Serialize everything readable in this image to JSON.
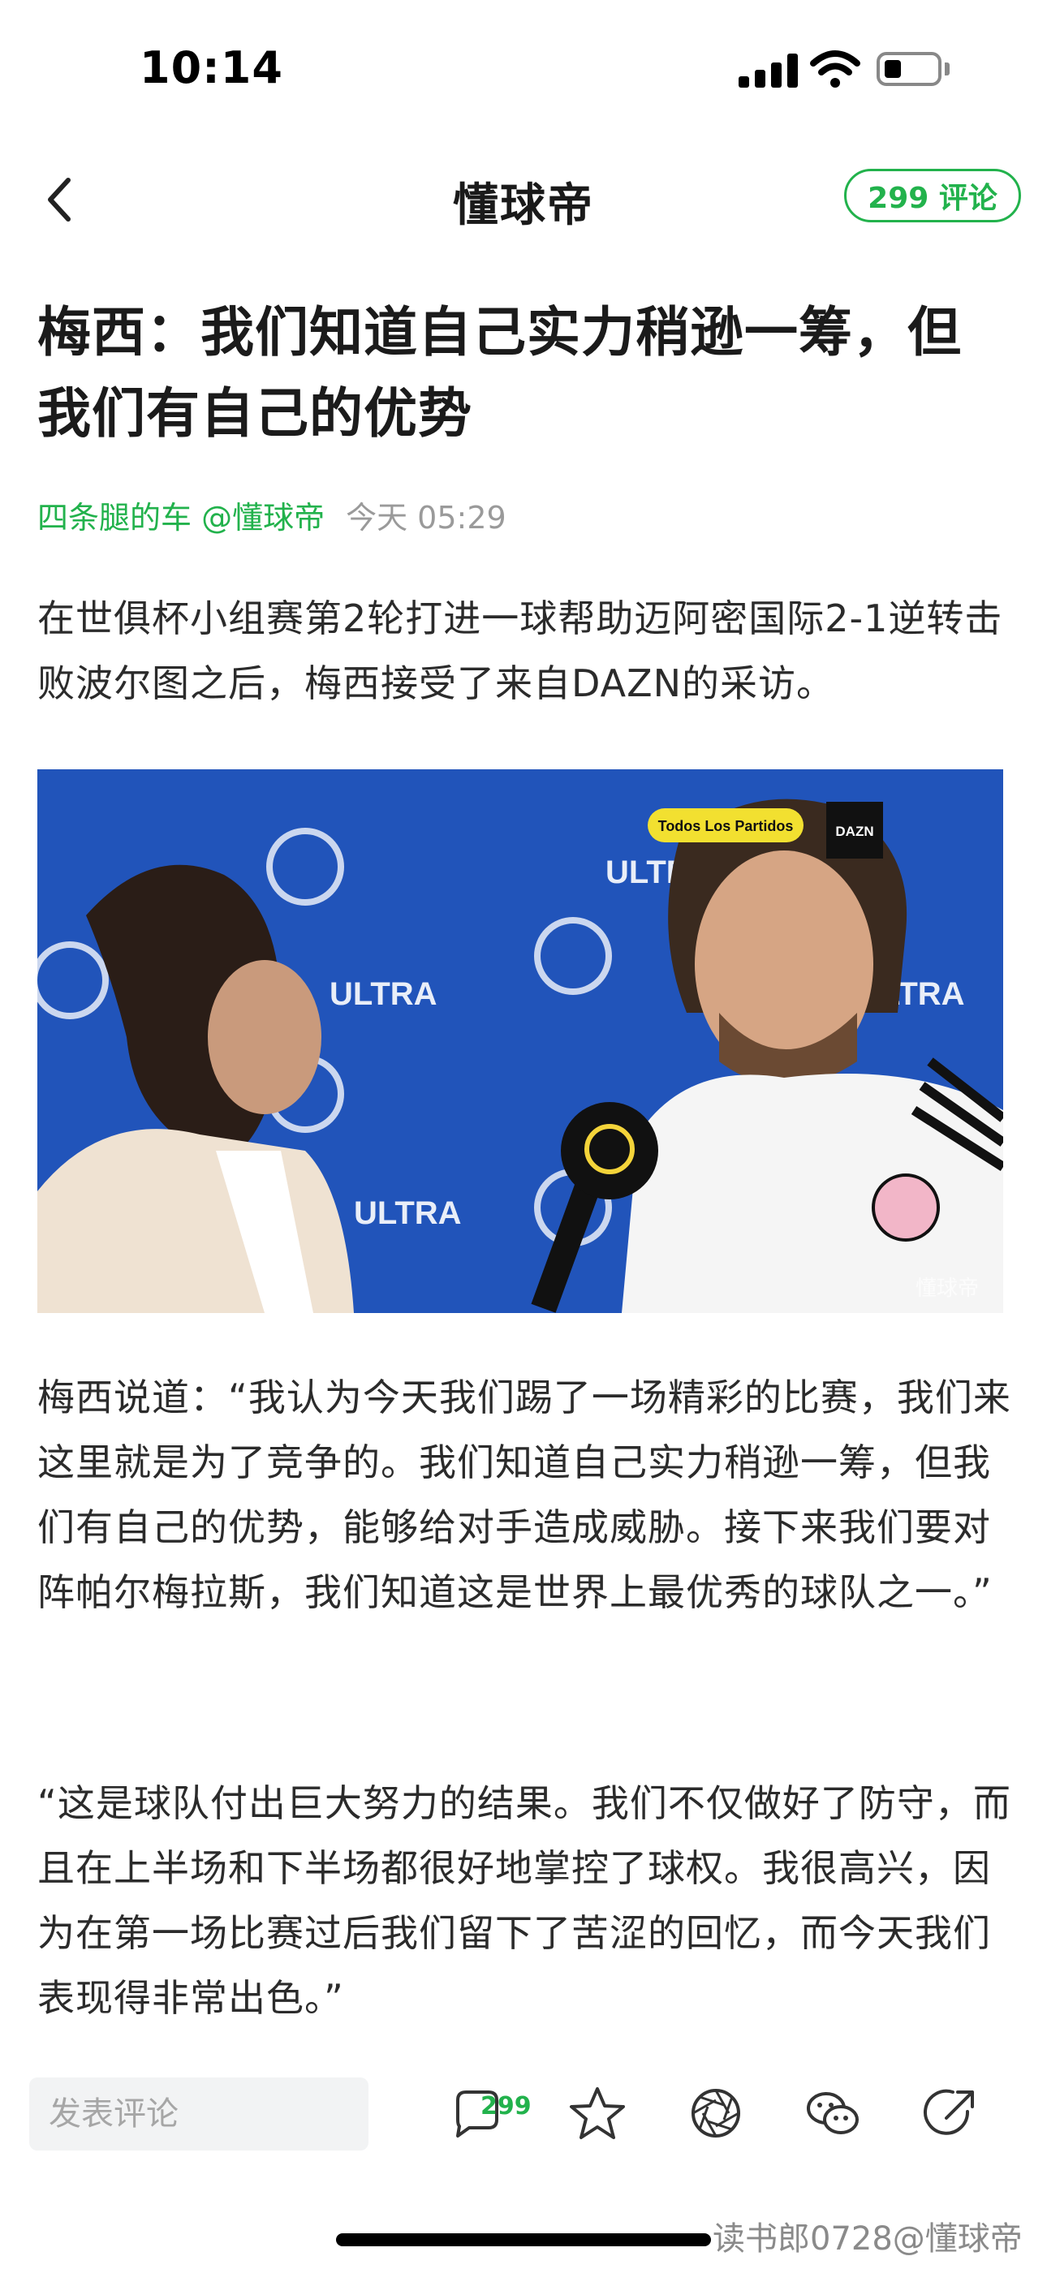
{
  "status_bar": {
    "time": "10:14"
  },
  "nav": {
    "title": "懂球帝",
    "comment_count_label": "299 评论"
  },
  "article": {
    "title": "梅西：我们知道自己实力稍逊一筹，但我们有自己的优势",
    "author": "四条腿的车 @懂球帝",
    "time": "今天 05:29",
    "paragraphs": [
      "在世俱杯小组赛第2轮打进一球帮助迈阿密国际2-1逆转击败波尔图之后，梅西接受了来自DAZN的采访。",
      "梅西说道：“我认为今天我们踢了一场精彩的比赛，我们来这里就是为了竞争的。我们知道自己实力稍逊一筹，但我们有自己的优势，能够给对手造成威胁。接下来我们要对阵帕尔梅拉斯，我们知道这是世界上最优秀的球队之一。”",
      "“这是球队付出巨大努力的结果。我们不仅做好了防守，而且在上半场和下半场都很好地掌控了球权。我很高兴，因为在第一场比赛过后我们留下了苦涩的回忆，而今天我们表现得非常出色。”"
    ],
    "image": {
      "tag": "Todos Los Partidos",
      "broadcaster": "DAZN",
      "backdrop_text": "ULTRA",
      "watermark": "懂球帝"
    }
  },
  "bottom_bar": {
    "comment_placeholder": "发表评论",
    "comment_badge": "299"
  },
  "overlay_watermark": "读书郎0728@懂球帝",
  "colors": {
    "accent": "#22b24c",
    "photo_bg": "#1e4fb5"
  }
}
